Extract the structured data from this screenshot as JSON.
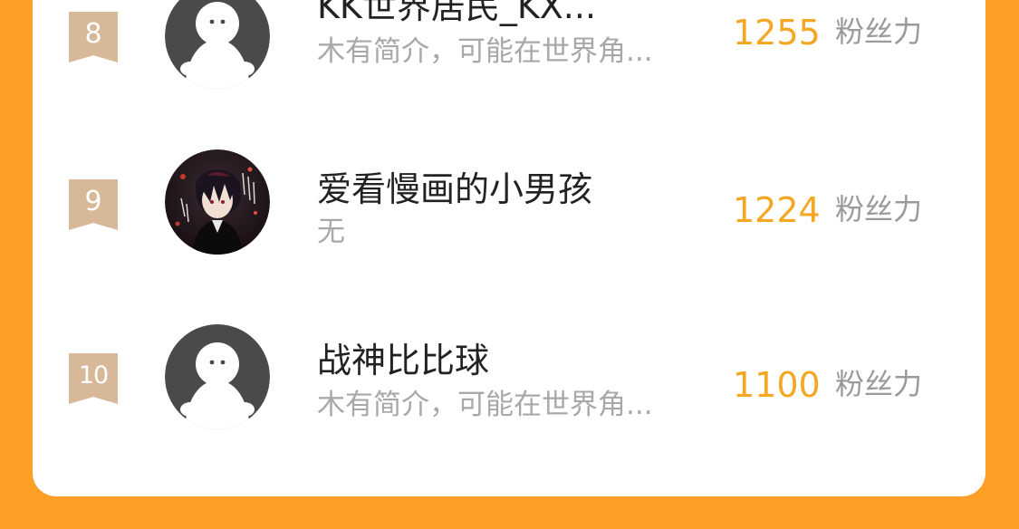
{
  "leaderboard": {
    "entries": [
      {
        "rank": "8",
        "name": "KK世界居民_KX...",
        "bio": "木有简介，可能在世界角...",
        "score": "1255",
        "score_unit": "粉丝力",
        "avatar": "default-avatar-icon"
      },
      {
        "rank": "9",
        "name": "爱看慢画的小男孩",
        "bio": "无",
        "score": "1224",
        "score_unit": "粉丝力",
        "avatar": "anime-avatar-image"
      },
      {
        "rank": "10",
        "name": "战神比比球",
        "bio": "木有简介，可能在世界角...",
        "score": "1100",
        "score_unit": "粉丝力",
        "avatar": "default-avatar-icon"
      }
    ]
  },
  "colors": {
    "page_background": "#FF9F25",
    "card_background": "#FFFFFF",
    "rank_badge": "#D7B898",
    "score": "#F5A623",
    "name_text": "#222222",
    "bio_text": "#A8A8A8"
  }
}
